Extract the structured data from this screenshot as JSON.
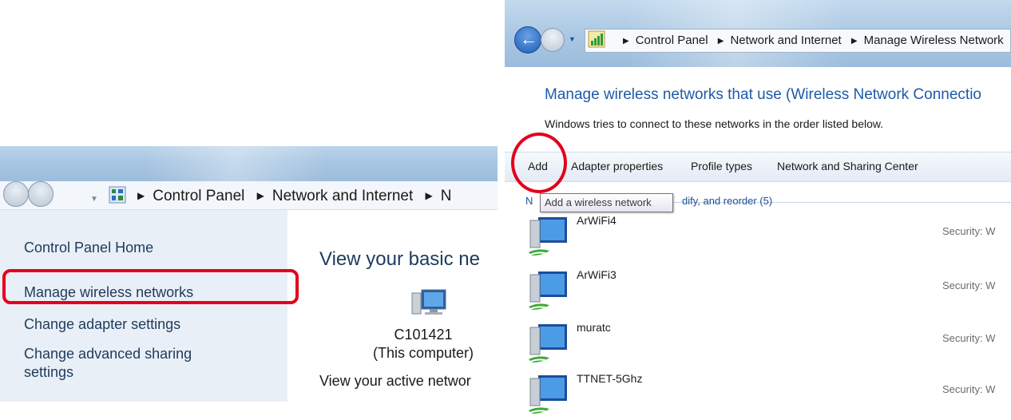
{
  "left_window": {
    "breadcrumb": [
      "Control Panel",
      "Network and Internet",
      "N"
    ],
    "sidebar": {
      "items": [
        {
          "label": "Control Panel Home"
        },
        {
          "label": "Manage wireless networks"
        },
        {
          "label": "Change adapter settings"
        },
        {
          "label": "Change advanced sharing"
        },
        {
          "label": "settings"
        }
      ]
    },
    "main": {
      "title": "View your basic ne",
      "computer_name": "C101421",
      "computer_note": "(This computer)",
      "active_label": "View your active networ"
    }
  },
  "right_window": {
    "breadcrumb": [
      "Control Panel",
      "Network and Internet",
      "Manage Wireless Network"
    ],
    "title": "Manage wireless networks that use (Wireless Network Connectio",
    "subtitle": "Windows tries to connect to these networks in the order listed below.",
    "toolbar": {
      "add": "Add",
      "adapter_properties": "Adapter properties",
      "profile_types": "Profile types",
      "network_sharing_center": "Network and Sharing Center"
    },
    "group_label_prefix": "N",
    "group_label_suffix": "dify, and reorder (5)",
    "tooltip": "Add a wireless network",
    "networks": [
      {
        "name": "ArWiFi4",
        "security": "Security: W"
      },
      {
        "name": "ArWiFi3",
        "security": "Security: W"
      },
      {
        "name": "muratc",
        "security": "Security: W"
      },
      {
        "name": "TTNET-5Ghz",
        "security": "Security: W"
      }
    ]
  },
  "colors": {
    "link_blue": "#1e5aa8",
    "highlight_red": "#e3001b",
    "sidebar_bg": "#e9eff6"
  }
}
